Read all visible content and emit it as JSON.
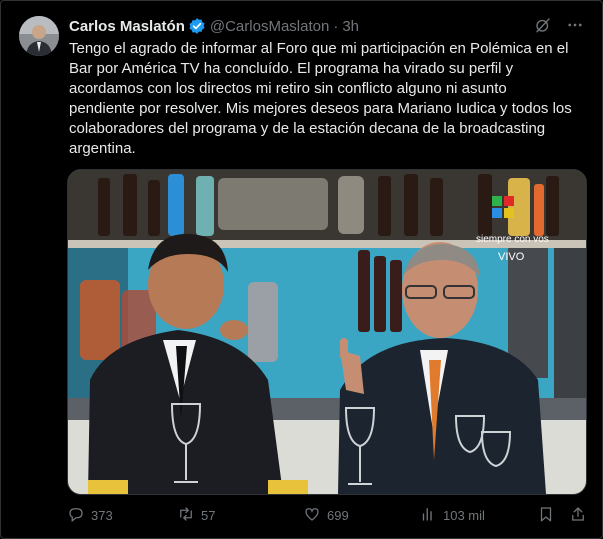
{
  "tweet": {
    "author_name": "Carlos Maslatón",
    "handle": "@CarlosMaslaton",
    "separator": "·",
    "time": "3h",
    "text": "Tengo el agrado de informar al Foro que mi participación en Polémica en el\nBar por América TV ha concluído. El programa ha virado su perfil y\nacordamos con los directos mi retiro sin conflicto alguno ni asunto\npendiente por resolver. Mis mejores deseos para Mariano Iudica y todos los\ncolaboradores del programa y de la estación decana de la broadcasting\nargentina.",
    "verified_color": "#1d9bf0"
  },
  "media": {
    "overlay_text_1": "siempre con vos",
    "overlay_text_2": "VIVO"
  },
  "icons": {
    "grok": "grok-icon",
    "more": "more-options-icon",
    "reply": "reply-icon",
    "retweet": "retweet-icon",
    "like": "like-icon",
    "views": "views-icon",
    "bookmark": "bookmark-icon",
    "share": "share-icon"
  },
  "actions": {
    "replies": "373",
    "retweets": "57",
    "likes": "699",
    "views": "103 mil"
  }
}
